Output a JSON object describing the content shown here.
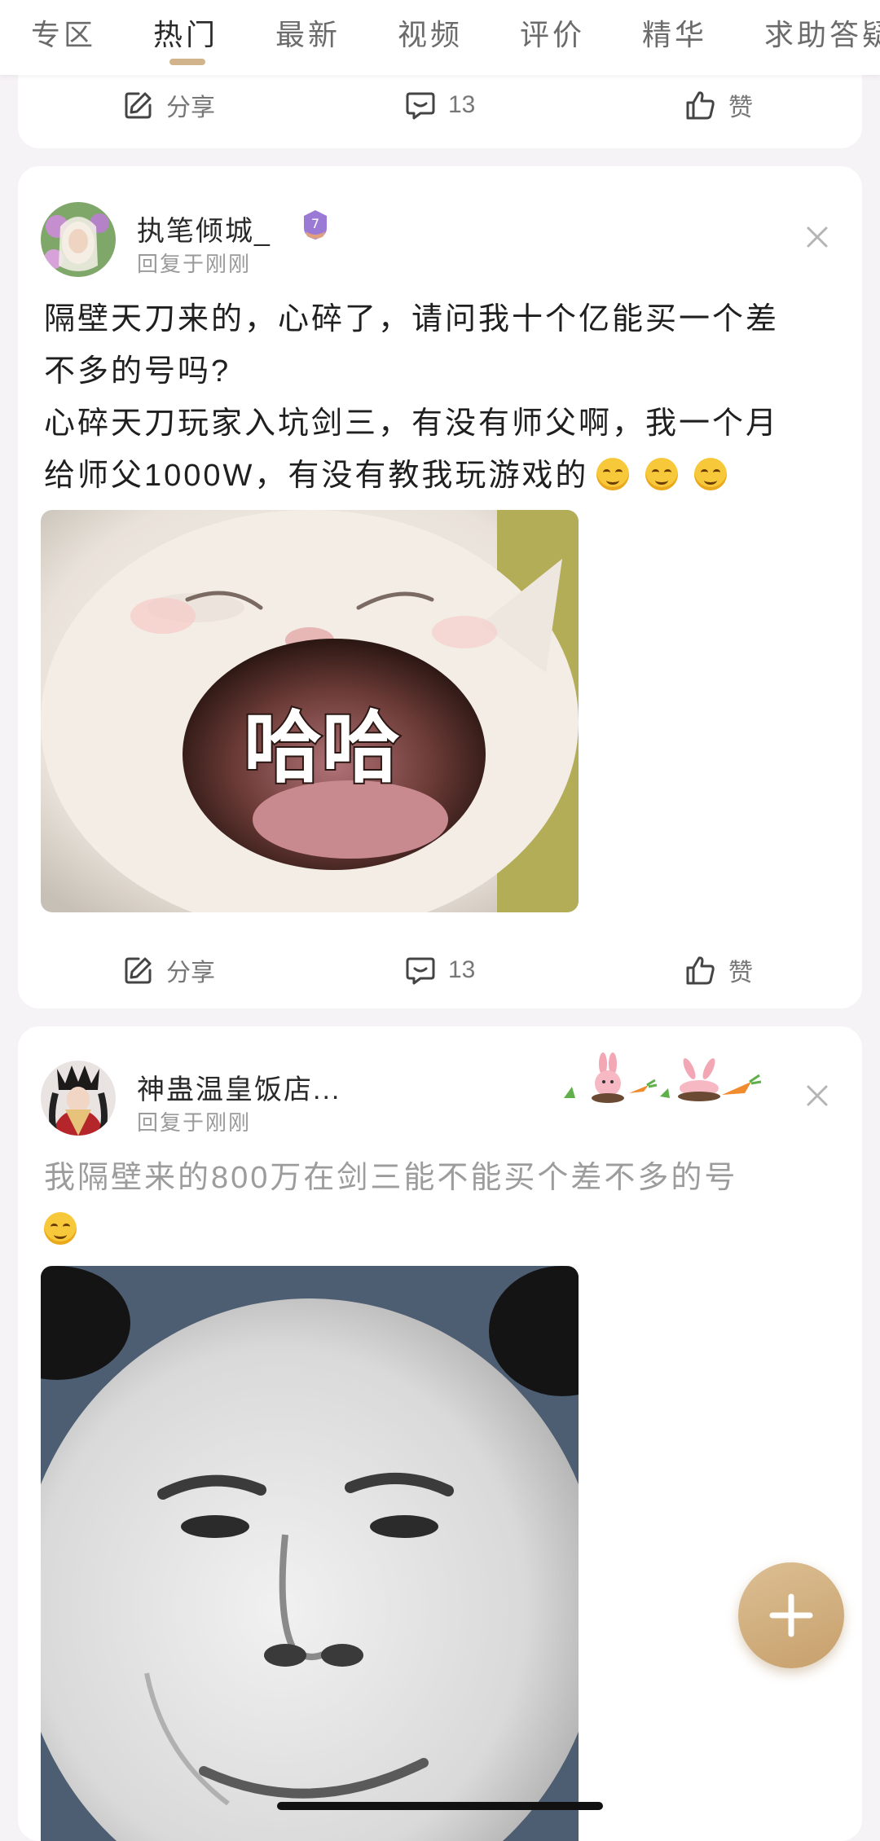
{
  "tabs": [
    "专区",
    "热门",
    "最新",
    "视频",
    "评价",
    "精华",
    "求助答疑"
  ],
  "active_tab": "热门",
  "actions": {
    "share": "分享",
    "comments": "13",
    "like": "赞"
  },
  "posts": [
    {
      "username": "执笔倾城_",
      "level": "7",
      "reply_time": "回复于刚刚",
      "text_line1": "隔壁天刀来的，心碎了，请问我十个亿能买一个差",
      "text_line2": "不多的号吗?",
      "text_line3": "心碎天刀玩家入坑剑三，有没有师父啊，我一个月",
      "text_line4": "给师父1000W，有没有教我玩游戏的",
      "image_caption": "哈哈"
    },
    {
      "username": "神蛊温皇饭店...",
      "reply_time": "回复于刚刚",
      "text_line1": "我隔壁来的800万在剑三能不能买个差不多的号"
    }
  ],
  "colors": {
    "accent": "#d2b48c",
    "fab": "#d4b282"
  },
  "icons": [
    "share-icon",
    "comment-icon",
    "thumbs-up-icon",
    "close-icon",
    "plus-icon"
  ]
}
